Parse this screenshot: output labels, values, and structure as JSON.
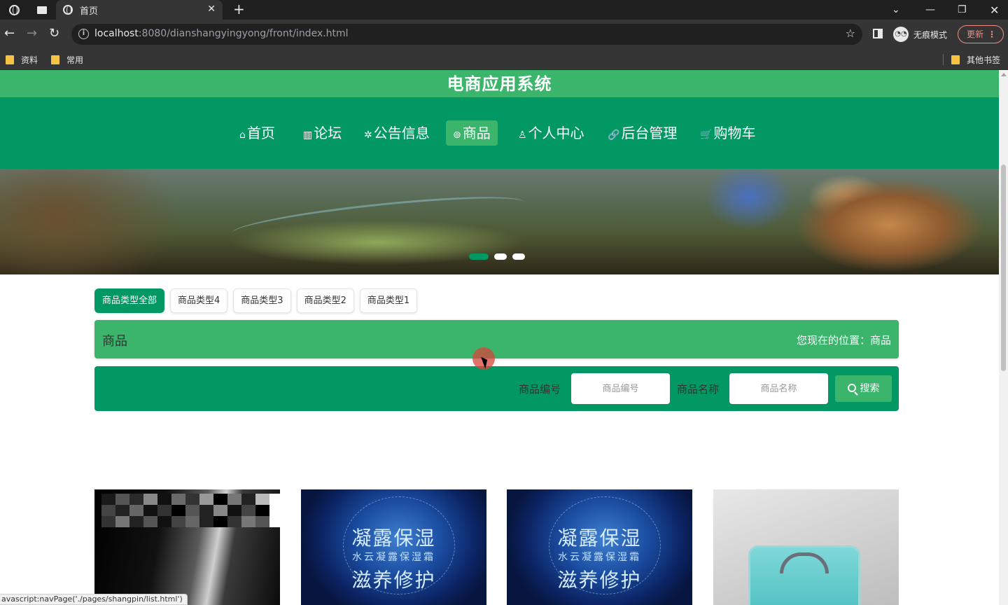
{
  "browser": {
    "tab_title": "首页",
    "url_host": "localhost",
    "url_rest": ":8080/dianshangyingyong/front/index.html",
    "incognito_label": "无痕模式",
    "update_label": "更新",
    "bookmarks": [
      "资料",
      "常用"
    ],
    "other_bookmarks": "其他书签",
    "status_url": "avascript:navPage('./pages/shangpin/list.html')"
  },
  "site": {
    "title": "电商应用系统",
    "nav": [
      {
        "icon": "⌂",
        "label": "首页"
      },
      {
        "icon": "▥",
        "label": "论坛"
      },
      {
        "icon": "✲",
        "label": "公告信息"
      },
      {
        "icon": "⊚",
        "label": "商品"
      },
      {
        "icon": "♙",
        "label": "个人中心"
      },
      {
        "icon": "🔗",
        "label": "后台管理"
      },
      {
        "icon": "🛒",
        "label": "购物车"
      }
    ]
  },
  "categories": [
    "商品类型全部",
    "商品类型4",
    "商品类型3",
    "商品类型2",
    "商品类型1"
  ],
  "breadcrumb": {
    "title": "商品",
    "location": "您现在的位置：商品"
  },
  "search": {
    "code_label": "商品编号",
    "code_placeholder": "商品编号",
    "name_label": "商品名称",
    "name_placeholder": "商品名称",
    "button_label": "搜索"
  },
  "products": {
    "card2": {
      "line1": "凝露保湿",
      "line2": "水云凝露保湿霜",
      "line3": "滋养修护"
    },
    "card3": {
      "line1": "凝露保湿",
      "line2": "水云凝露保湿霜",
      "line3": "滋养修护"
    }
  },
  "colors": {
    "primary": "#029864",
    "secondary": "#3bb46c"
  }
}
